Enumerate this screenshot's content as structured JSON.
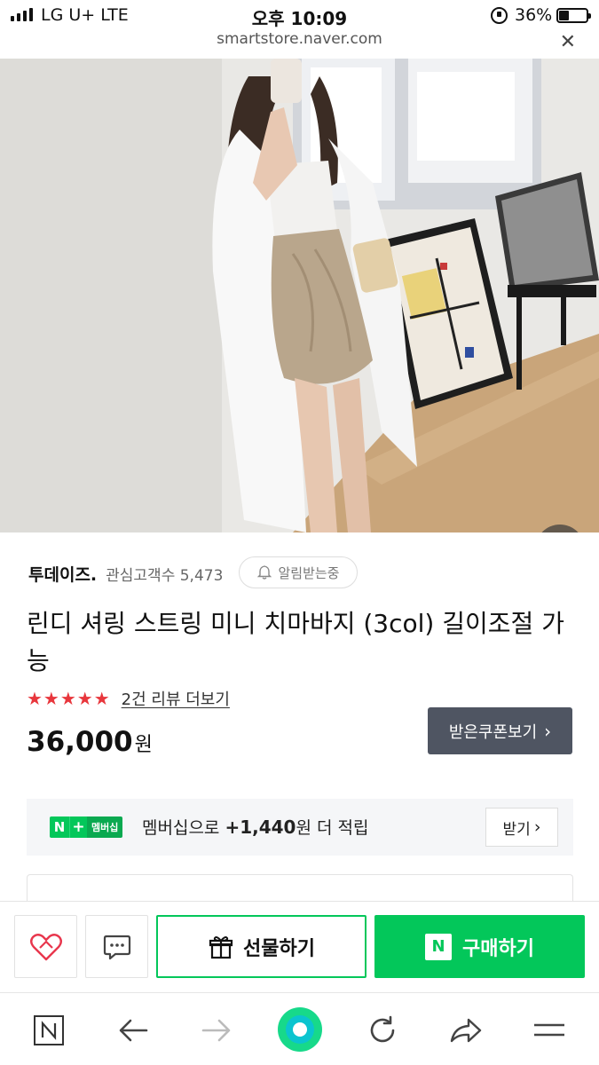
{
  "status_bar": {
    "carrier": "LG U+  LTE",
    "time": "오후 10:09",
    "battery": "36%",
    "battery_level": 0.36
  },
  "browser": {
    "url": "smartstore.naver.com",
    "close_icon": "close-icon"
  },
  "hero": {
    "image_subject": "product-photo",
    "zoom_icon": "magnifier-icon"
  },
  "store": {
    "name": "투데이즈.",
    "fans_label": "관심고객수 5,473",
    "alarm_label": "알림받는중",
    "alarm_icon": "bell-icon"
  },
  "product": {
    "title": "린디 셔링 스트링 미니 치마바지 (3col) 길이조절 가능",
    "rating_stars": 5,
    "review_link": "2건 리뷰 더보기",
    "price": "36,000",
    "price_unit": "원",
    "coupon_button": "받은쿠폰보기"
  },
  "membership": {
    "badge_n": "N",
    "badge_plus": "+",
    "badge_text": "멤버십",
    "prefix": "멤버십으로 ",
    "amount": "+1,440",
    "suffix": "원 더 적립",
    "receive_button": "받기"
  },
  "action_bar": {
    "like_icon": "heart-icon",
    "talk_icon": "chat-icon",
    "gift_label": "선물하기",
    "gift_icon": "gift-icon",
    "buy_label": "구매하기",
    "buy_logo": "N"
  },
  "toolbar": {
    "items": [
      "naver-home-icon",
      "back-arrow-icon",
      "forward-arrow-icon",
      "green-dot-icon",
      "refresh-icon",
      "share-icon",
      "menu-icon"
    ]
  },
  "colors": {
    "brand_green": "#03c75a",
    "star_red": "#e8363c",
    "coupon_bg": "#4f5562"
  }
}
